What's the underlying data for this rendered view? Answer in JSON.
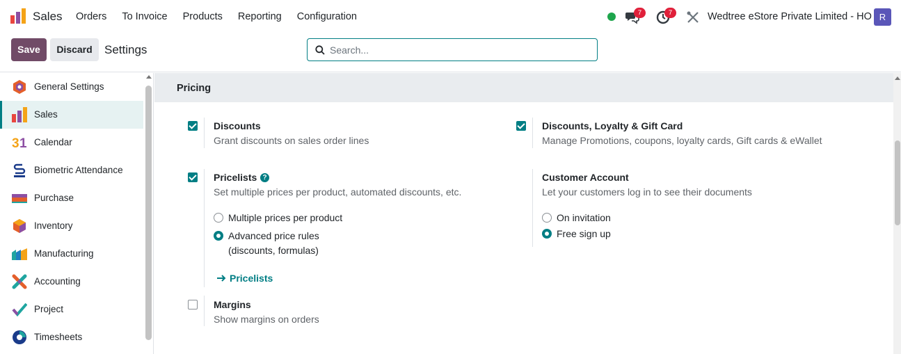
{
  "topbar": {
    "app_name": "Sales",
    "menu": [
      "Orders",
      "To Invoice",
      "Products",
      "Reporting",
      "Configuration"
    ],
    "messages_badge": "7",
    "activities_badge": "7",
    "company": "Wedtree eStore Private Limited - HO",
    "avatar_letter": "R",
    "colors": {
      "status_online": "#1ea54c",
      "badge": "#e0203a",
      "avatar": "#5a56b8"
    }
  },
  "control": {
    "save_label": "Save",
    "discard_label": "Discard",
    "breadcrumb": "Settings",
    "search_placeholder": "Search..."
  },
  "sidebar": {
    "items": [
      {
        "label": "General Settings",
        "icon": "general-settings-icon"
      },
      {
        "label": "Sales",
        "icon": "sales-icon",
        "active": true
      },
      {
        "label": "Calendar",
        "icon": "calendar-icon"
      },
      {
        "label": "Biometric Attendance",
        "icon": "biometric-icon"
      },
      {
        "label": "Purchase",
        "icon": "purchase-icon"
      },
      {
        "label": "Inventory",
        "icon": "inventory-icon"
      },
      {
        "label": "Manufacturing",
        "icon": "manufacturing-icon"
      },
      {
        "label": "Accounting",
        "icon": "accounting-icon"
      },
      {
        "label": "Project",
        "icon": "project-icon"
      },
      {
        "label": "Timesheets",
        "icon": "timesheets-icon"
      }
    ]
  },
  "pricing": {
    "section_title": "Pricing",
    "discounts": {
      "title": "Discounts",
      "desc": "Grant discounts on sales order lines",
      "checked": true
    },
    "loyalty": {
      "title": "Discounts, Loyalty & Gift Card",
      "desc": "Manage Promotions, coupons, loyalty cards, Gift cards & eWallet",
      "checked": true
    },
    "pricelists": {
      "title": "Pricelists",
      "desc": "Set multiple prices per product, automated discounts, etc.",
      "checked": true,
      "options": [
        "Multiple prices per product",
        "Advanced price rules",
        "(discounts, formulas)"
      ],
      "selected": "Advanced price rules",
      "link_label": "Pricelists"
    },
    "customer_account": {
      "title": "Customer Account",
      "desc": "Let your customers log in to see their documents",
      "options": [
        "On invitation",
        "Free sign up"
      ],
      "selected": "Free sign up"
    },
    "margins": {
      "title": "Margins",
      "desc": "Show margins on orders",
      "checked": false
    }
  },
  "theme": {
    "primary": "#714b67",
    "accent": "#017e84"
  }
}
